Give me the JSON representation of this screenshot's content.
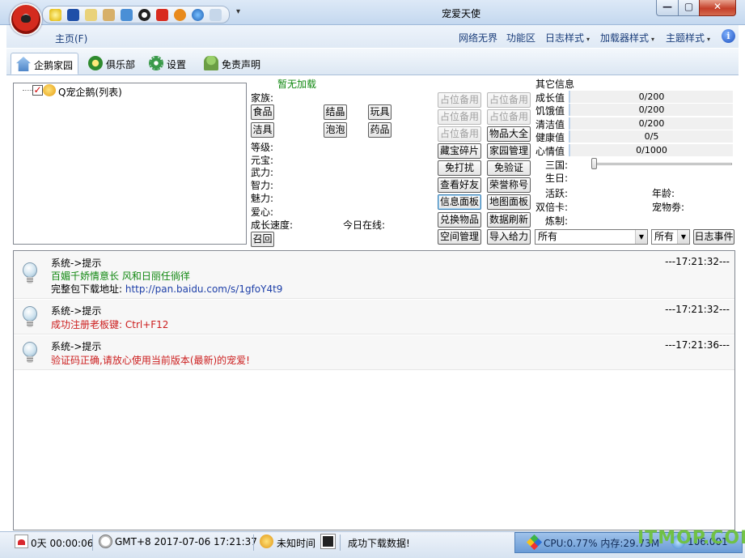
{
  "window": {
    "title": "宠爱天使",
    "min_label": "▭",
    "max_label": "▢",
    "close_label": "✕"
  },
  "menu": {
    "home": "主页(F)",
    "items": [
      "网络无界",
      "功能区",
      "日志样式",
      "加载器样式",
      "主题样式"
    ],
    "help_label": "i"
  },
  "tabs": [
    "企鹅家园",
    "俱乐部",
    "设置",
    "免责声明"
  ],
  "tree": {
    "node_label": "Q宠企鹅(列表)"
  },
  "pet": {
    "status": "暂无加载",
    "family_label": "家族:",
    "buttons_row1": [
      "食品",
      "结晶",
      "玩具"
    ],
    "buttons_row2": [
      "洁具",
      "泡泡",
      "药品"
    ],
    "attrs": [
      "等级:",
      "元宝:",
      "武力:",
      "智力:",
      "魅力:",
      "爱心:"
    ],
    "growth_speed_label": "成长速度:",
    "online_today_label": "今日在线:",
    "recall_button": "召回"
  },
  "actions": {
    "row1": [
      "占位备用",
      "占位备用"
    ],
    "row2": [
      "占位备用",
      "占位备用"
    ],
    "row3": [
      "占位备用",
      "物品大全"
    ],
    "row4": [
      "藏宝碎片",
      "家园管理"
    ],
    "row5": [
      "免打扰",
      "免验证"
    ],
    "row6": [
      "查看好友",
      "荣誉称号"
    ],
    "row7": [
      "信息面板",
      "地图面板"
    ],
    "row8": [
      "兑换物品",
      "数据刷新"
    ],
    "row9": [
      "空间管理",
      "导入给力"
    ]
  },
  "info": {
    "header": "其它信息",
    "stats": [
      {
        "label": "成长值",
        "value": "0/200"
      },
      {
        "label": "饥饿值",
        "value": "0/200"
      },
      {
        "label": "清洁值",
        "value": "0/200"
      },
      {
        "label": "健康值",
        "value": "0/5"
      },
      {
        "label": "心情值",
        "value": "0/1000"
      }
    ],
    "sanguo_label": "三国:",
    "birthday_label": "生日:",
    "active_label": "活跃:",
    "age_label": "年龄:",
    "double_card_label": "双倍卡:",
    "pet_coupon_label": "宠物劵:",
    "refine_label": "炼制:",
    "filter1": "所有",
    "filter2": "所有",
    "log_event_button": "日志事件"
  },
  "log": [
    {
      "title": "系统->提示",
      "time": "---17:21:32---",
      "line1": "百媚千娇情意长 风和日丽任徜徉",
      "line2_prefix": "完整包下载地址: ",
      "line2_link": "http://pan.baidu.com/s/1gfoY4t9"
    },
    {
      "title": "系统->提示",
      "time": "---17:21:32---",
      "line1": "成功注册老板键: Ctrl+F12"
    },
    {
      "title": "系统->提示",
      "time": "---17:21:36---",
      "line1": "验证码正确,请放心使用当前版本(最新)的宠爱!"
    }
  ],
  "status": {
    "uptime": "0天 00:00:06",
    "clock": "GMT+8 2017-07-06 17:21:37",
    "unknown_time": "未知时间",
    "download": "成功下载数据!",
    "cpu": "CPU:0.77% 内存:29.73M",
    "extra": "106.001",
    "watermark": "ITMOP.COM"
  },
  "colors": {
    "accent": "#1a3d7a",
    "green_text": "#118811",
    "red_text": "#cc1d1d",
    "link": "#1d3fa8"
  }
}
